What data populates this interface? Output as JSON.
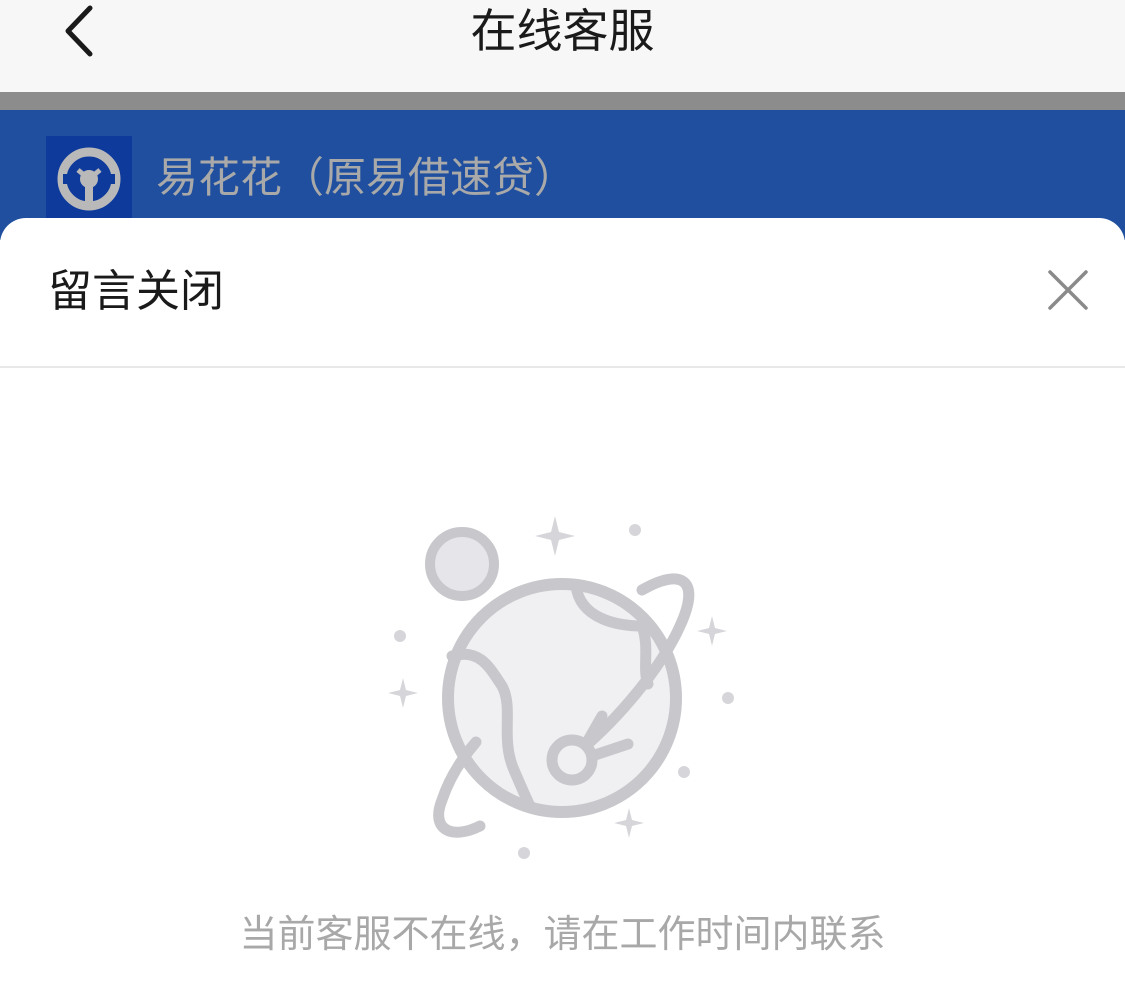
{
  "navbar": {
    "title": "在线客服",
    "back_icon": "chevron-left-icon"
  },
  "brand": {
    "name": "易花花（原易借速贷）",
    "logo_icon": "brand-logo-icon",
    "bar_color": "#1f4f9e"
  },
  "sheet": {
    "title": "留言关闭",
    "close_icon": "close-icon",
    "illustration": "planet-empty-state-icon",
    "message": "当前客服不在线，请在工作时间内联系"
  },
  "colors": {
    "navbar_bg": "#f7f7f7",
    "brand_bar": "#1f4f9e",
    "muted_text": "#a8a8a8",
    "title_text": "#1a1a1a"
  }
}
